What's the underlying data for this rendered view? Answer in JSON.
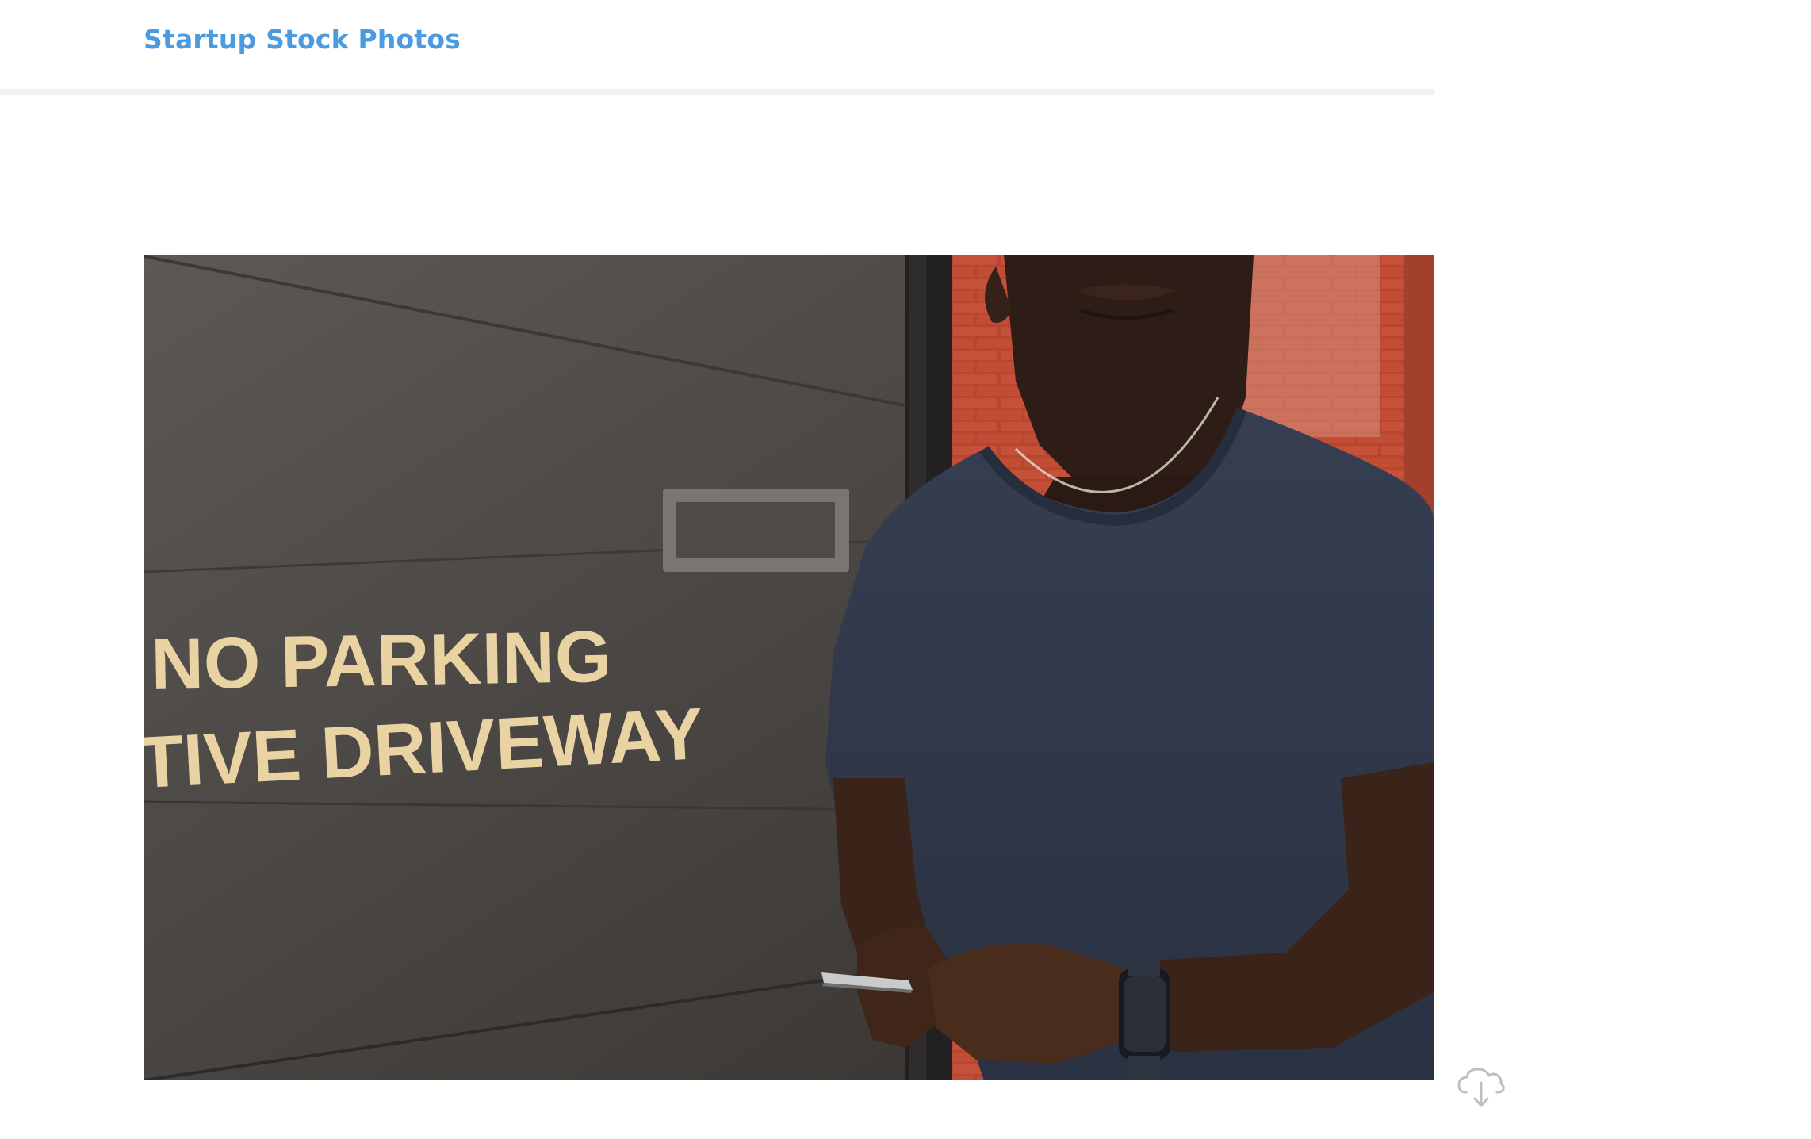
{
  "header": {
    "site_title": "Startup Stock Photos",
    "site_title_color": "#4a9be0"
  },
  "photo": {
    "sign_line_1": "NO PARKING",
    "sign_line_2": "TIVE DRIVEWAY"
  },
  "actions": {
    "download_icon": "cloud-download-icon"
  }
}
